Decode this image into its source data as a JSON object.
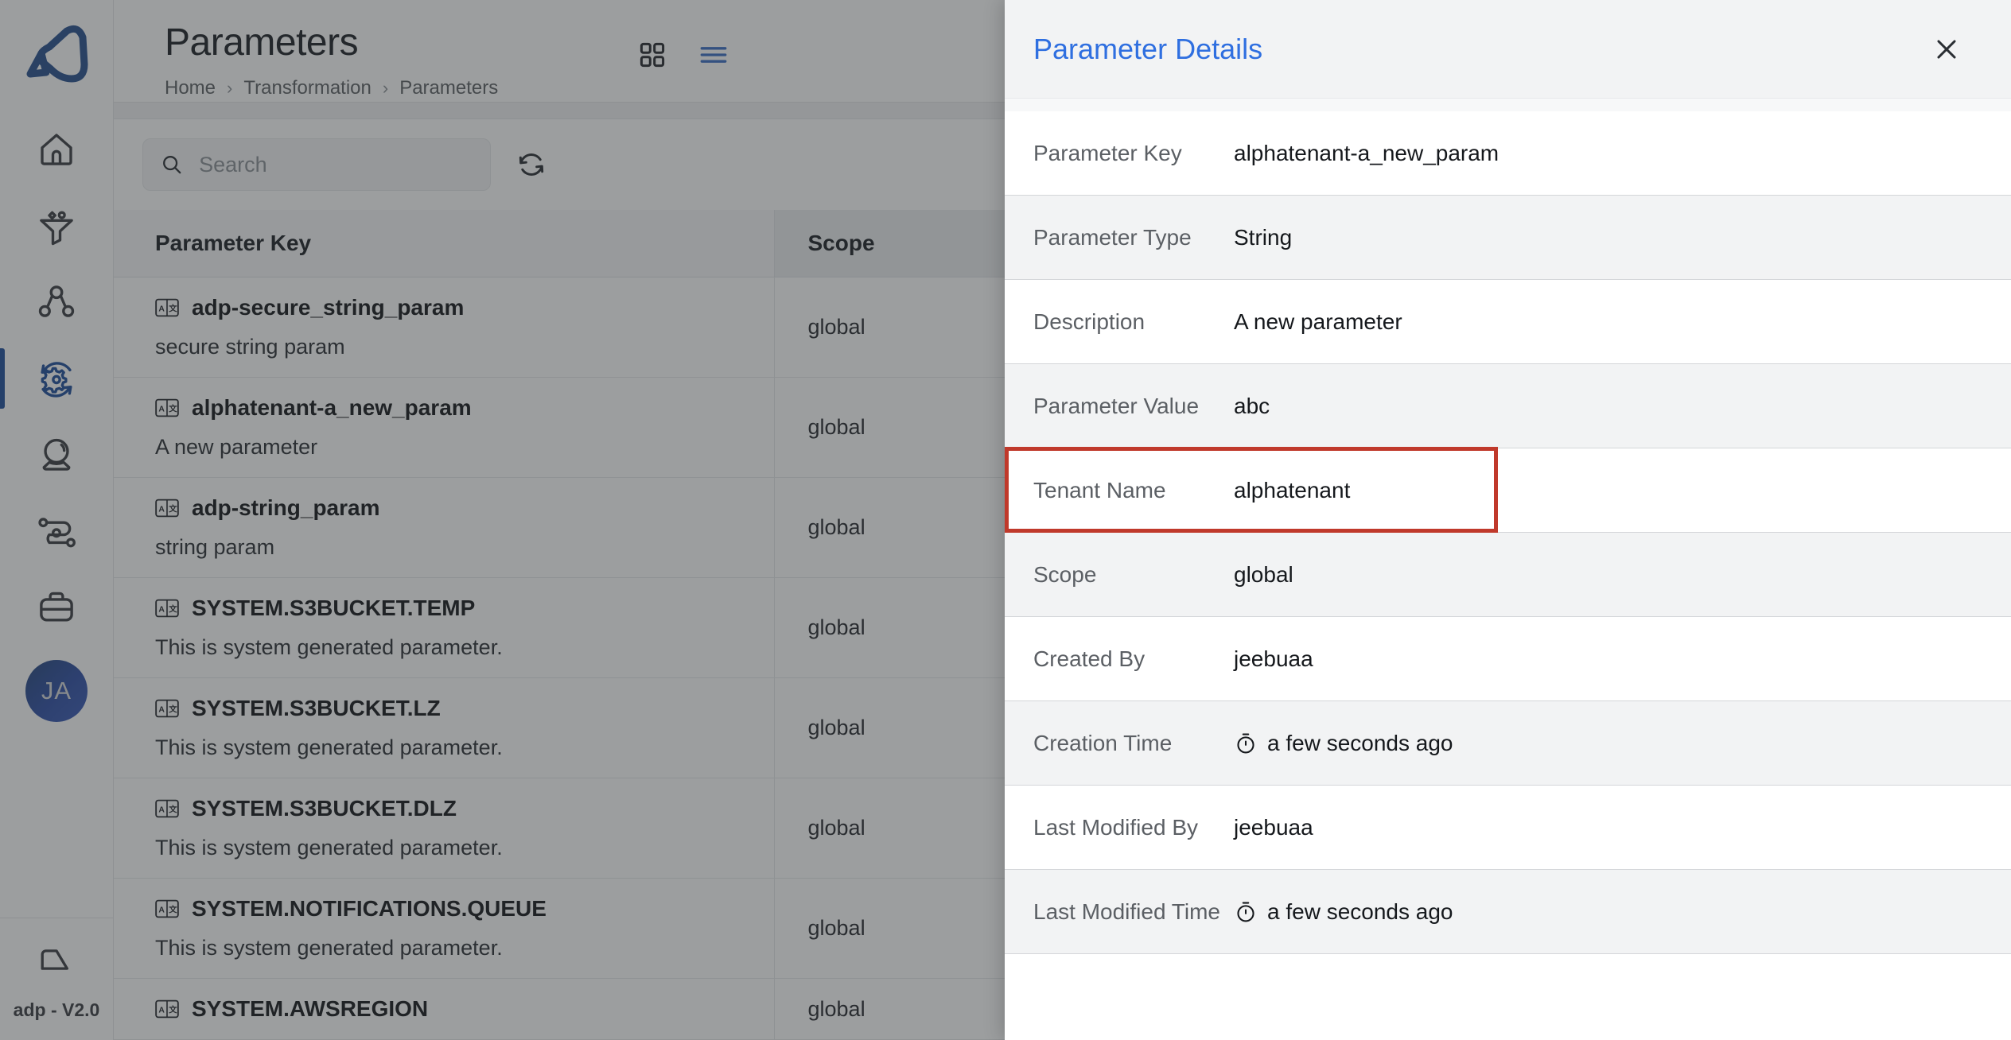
{
  "sidebar": {
    "logo_name": "adp-logo",
    "items": [
      {
        "icon": "home-icon",
        "name": "home",
        "active": false
      },
      {
        "icon": "funnel-icon",
        "name": "ingestion",
        "active": false
      },
      {
        "icon": "hierarchy-icon",
        "name": "organization",
        "active": false
      },
      {
        "icon": "gear-sync-icon",
        "name": "transformation",
        "active": true
      },
      {
        "icon": "crystal-ball-icon",
        "name": "insights",
        "active": false
      },
      {
        "icon": "pipeline-icon",
        "name": "workflows",
        "active": false
      },
      {
        "icon": "briefcase-icon",
        "name": "administration",
        "active": false
      }
    ],
    "avatar_initials": "JA",
    "version_label": "adp - V2.0"
  },
  "header": {
    "title": "Parameters",
    "breadcrumb": [
      "Home",
      "Transformation",
      "Parameters"
    ],
    "breadcrumb_separator": "›",
    "view_toggle": {
      "grid_icon": "grid-view-icon",
      "list_icon": "list-view-icon",
      "active": "list",
      "active_color": "#3b6fc4"
    }
  },
  "search": {
    "placeholder": "Search",
    "value": "",
    "search_icon": "search-icon",
    "refresh_icon": "refresh-icon"
  },
  "table": {
    "columns": [
      "Parameter Key",
      "Scope"
    ],
    "rows": [
      {
        "key": "adp-secure_string_param",
        "description": "secure string param",
        "scope": "global",
        "icon": "string-type-icon"
      },
      {
        "key": "alphatenant-a_new_param",
        "description": "A new parameter",
        "scope": "global",
        "icon": "string-type-icon"
      },
      {
        "key": "adp-string_param",
        "description": "string param",
        "scope": "global",
        "icon": "string-type-icon"
      },
      {
        "key": "SYSTEM.S3BUCKET.TEMP",
        "description": "This is system generated parameter.",
        "scope": "global",
        "icon": "string-type-icon"
      },
      {
        "key": "SYSTEM.S3BUCKET.LZ",
        "description": "This is system generated parameter.",
        "scope": "global",
        "icon": "string-type-icon"
      },
      {
        "key": "SYSTEM.S3BUCKET.DLZ",
        "description": "This is system generated parameter.",
        "scope": "global",
        "icon": "string-type-icon"
      },
      {
        "key": "SYSTEM.NOTIFICATIONS.QUEUE",
        "description": "This is system generated parameter.",
        "scope": "global",
        "icon": "string-type-icon"
      },
      {
        "key": "SYSTEM.AWSREGION",
        "description": "",
        "scope": "global",
        "icon": "string-type-icon"
      }
    ]
  },
  "panel": {
    "title": "Parameter Details",
    "title_color": "#2f6fe0",
    "close_icon": "close-icon",
    "highlight_color": "#c0392b",
    "highlighted_row": "Tenant Name",
    "rows": [
      {
        "label": "Parameter Key",
        "value": "alphatenant-a_new_param",
        "icon": ""
      },
      {
        "label": "Parameter Type",
        "value": "String",
        "icon": ""
      },
      {
        "label": "Description",
        "value": "A new parameter",
        "icon": ""
      },
      {
        "label": "Parameter Value",
        "value": "abc",
        "icon": ""
      },
      {
        "label": "Tenant Name",
        "value": "alphatenant",
        "icon": ""
      },
      {
        "label": "Scope",
        "value": "global",
        "icon": ""
      },
      {
        "label": "Created By",
        "value": "jeebuaa",
        "icon": ""
      },
      {
        "label": "Creation Time",
        "value": "a few seconds ago",
        "icon": "stopwatch-icon"
      },
      {
        "label": "Last Modified By",
        "value": "jeebuaa",
        "icon": ""
      },
      {
        "label": "Last Modified Time",
        "value": "a few seconds ago",
        "icon": "stopwatch-icon"
      }
    ]
  }
}
